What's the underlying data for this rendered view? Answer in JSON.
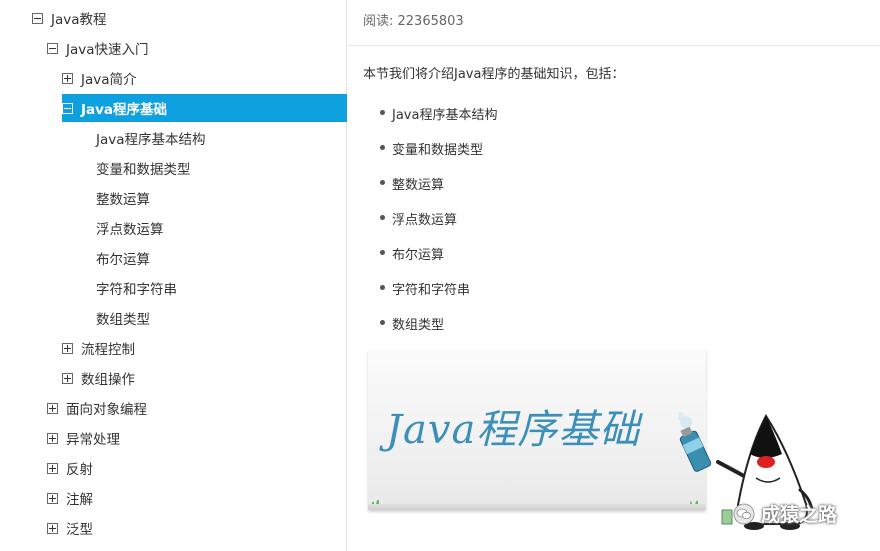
{
  "sidebar": {
    "items": [
      {
        "label": "Java教程",
        "level": 0,
        "toggle": "minus",
        "active": false
      },
      {
        "label": "Java快速入门",
        "level": 1,
        "toggle": "minus",
        "active": false
      },
      {
        "label": "Java简介",
        "level": 2,
        "toggle": "plus",
        "active": false
      },
      {
        "label": "Java程序基础",
        "level": 2,
        "toggle": "minus",
        "active": true
      },
      {
        "label": "Java程序基本结构",
        "level": 3,
        "toggle": "none",
        "active": false
      },
      {
        "label": "变量和数据类型",
        "level": 3,
        "toggle": "none",
        "active": false
      },
      {
        "label": "整数运算",
        "level": 3,
        "toggle": "none",
        "active": false
      },
      {
        "label": "浮点数运算",
        "level": 3,
        "toggle": "none",
        "active": false
      },
      {
        "label": "布尔运算",
        "level": 3,
        "toggle": "none",
        "active": false
      },
      {
        "label": "字符和字符串",
        "level": 3,
        "toggle": "none",
        "active": false
      },
      {
        "label": "数组类型",
        "level": 3,
        "toggle": "none",
        "active": false
      },
      {
        "label": "流程控制",
        "level": 2,
        "toggle": "plus",
        "active": false
      },
      {
        "label": "数组操作",
        "level": 2,
        "toggle": "plus",
        "active": false
      },
      {
        "label": "面向对象编程",
        "level": 1,
        "toggle": "plus",
        "active": false
      },
      {
        "label": "异常处理",
        "level": 1,
        "toggle": "plus",
        "active": false
      },
      {
        "label": "反射",
        "level": 1,
        "toggle": "plus",
        "active": false
      },
      {
        "label": "注解",
        "level": 1,
        "toggle": "plus",
        "active": false
      },
      {
        "label": "泛型",
        "level": 1,
        "toggle": "plus",
        "active": false
      }
    ]
  },
  "main": {
    "reads": "阅读: 22365803",
    "intro": "本节我们将介绍Java程序的基础知识，包括：",
    "toc": [
      "Java程序基本结构",
      "变量和数据类型",
      "整数运算",
      "浮点数运算",
      "布尔运算",
      "字符和字符串",
      "数组类型"
    ],
    "banner_title": "Java程序基础"
  },
  "watermark": {
    "text": "成猿之路"
  },
  "colors": {
    "active_bg": "#0fa0e0",
    "banner_text": "#3c8fb8",
    "mascot_nose": "#e02020"
  }
}
